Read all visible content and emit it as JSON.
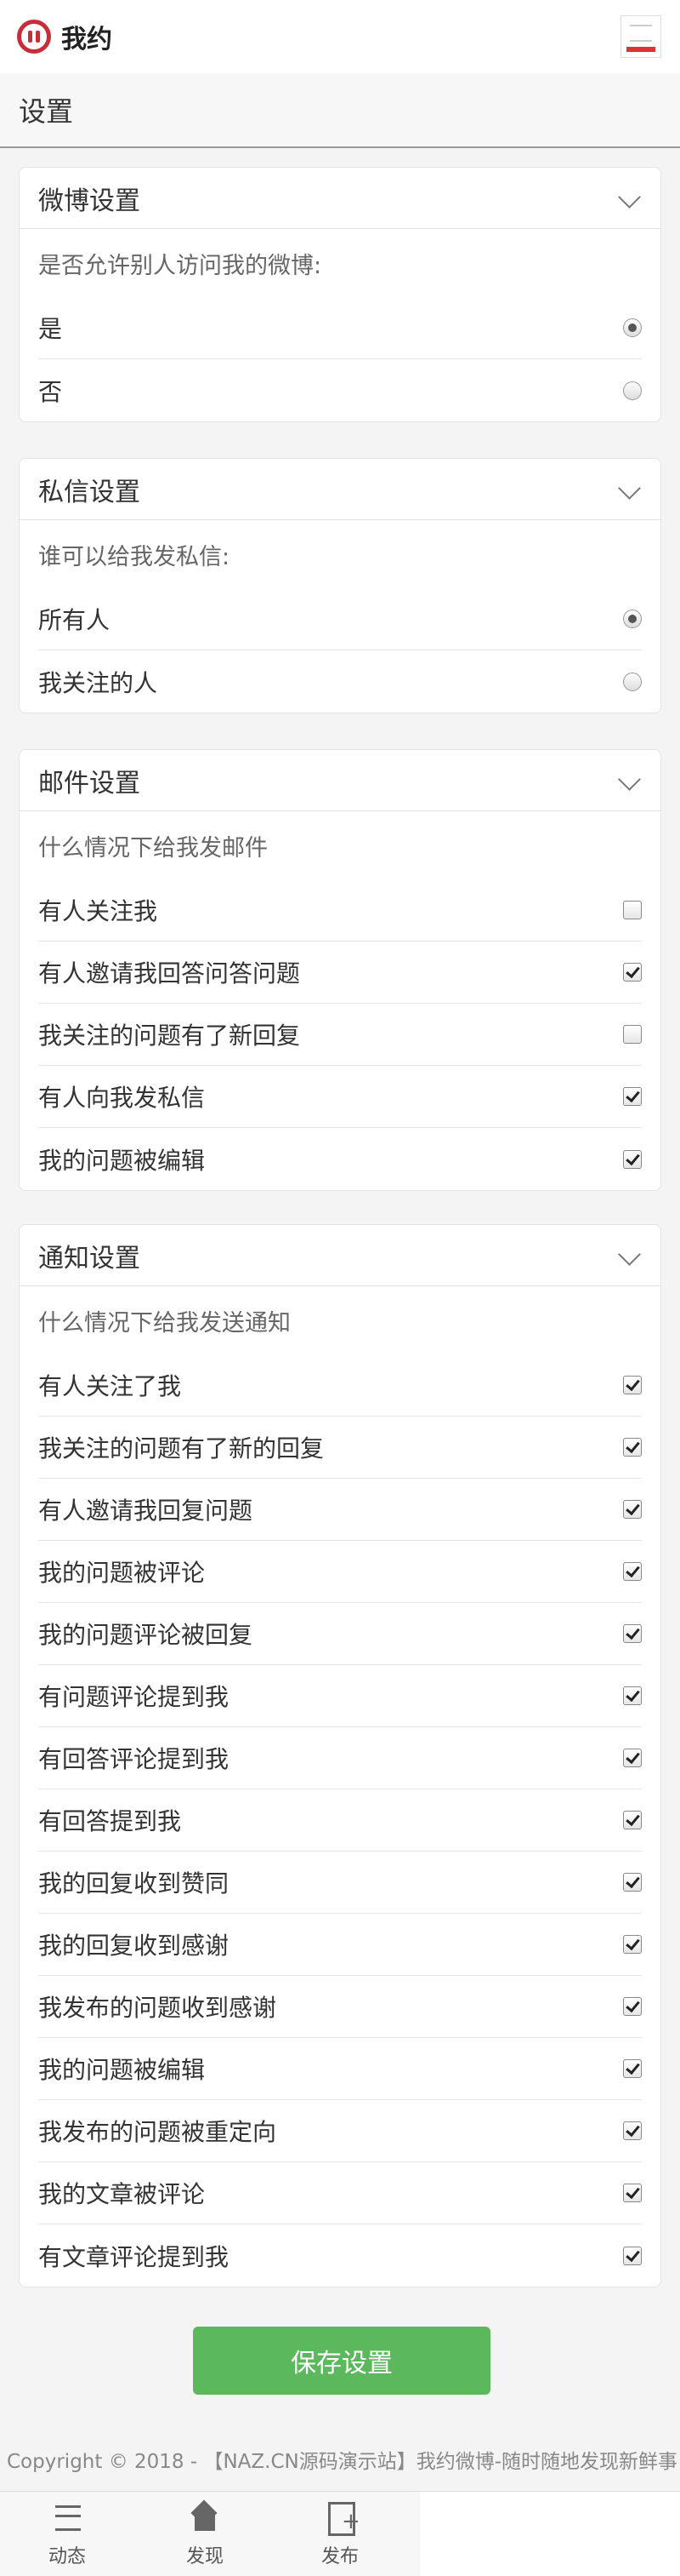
{
  "header": {
    "brand": "我约"
  },
  "page": {
    "title": "设置"
  },
  "weibo": {
    "title": "微博设置",
    "question": "是否允许别人访问我的微博:",
    "options": [
      {
        "label": "是",
        "checked": true
      },
      {
        "label": "否",
        "checked": false
      }
    ]
  },
  "message": {
    "title": "私信设置",
    "question": "谁可以给我发私信:",
    "options": [
      {
        "label": "所有人",
        "checked": true
      },
      {
        "label": "我关注的人",
        "checked": false
      }
    ]
  },
  "email": {
    "title": "邮件设置",
    "question": "什么情况下给我发邮件",
    "items": [
      {
        "label": "有人关注我",
        "checked": false
      },
      {
        "label": "有人邀请我回答问答问题",
        "checked": true
      },
      {
        "label": "我关注的问题有了新回复",
        "checked": false
      },
      {
        "label": "有人向我发私信",
        "checked": true
      },
      {
        "label": "我的问题被编辑",
        "checked": true
      }
    ]
  },
  "notify": {
    "title": "通知设置",
    "question": "什么情况下给我发送通知",
    "items": [
      {
        "label": "有人关注了我",
        "checked": true
      },
      {
        "label": "我关注的问题有了新的回复",
        "checked": true
      },
      {
        "label": "有人邀请我回复问题",
        "checked": true
      },
      {
        "label": "我的问题被评论",
        "checked": true
      },
      {
        "label": "我的问题评论被回复",
        "checked": true
      },
      {
        "label": "有问题评论提到我",
        "checked": true
      },
      {
        "label": "有回答评论提到我",
        "checked": true
      },
      {
        "label": "有回答提到我",
        "checked": true
      },
      {
        "label": "我的回复收到赞同",
        "checked": true
      },
      {
        "label": "我的回复收到感谢",
        "checked": true
      },
      {
        "label": "我发布的问题收到感谢",
        "checked": true
      },
      {
        "label": "我的问题被编辑",
        "checked": true
      },
      {
        "label": "我发布的问题被重定向",
        "checked": true
      },
      {
        "label": "我的文章被评论",
        "checked": true
      },
      {
        "label": "有文章评论提到我",
        "checked": true
      }
    ]
  },
  "save_label": "保存设置",
  "copyright": "Copyright © 2018 - 【NAZ.CN源码演示站】我约微博-随时随地发现新鲜事",
  "nav": [
    {
      "label": "动态",
      "icon": "list-icon"
    },
    {
      "label": "发现",
      "icon": "home-icon"
    },
    {
      "label": "发布",
      "icon": "publish-icon"
    }
  ]
}
